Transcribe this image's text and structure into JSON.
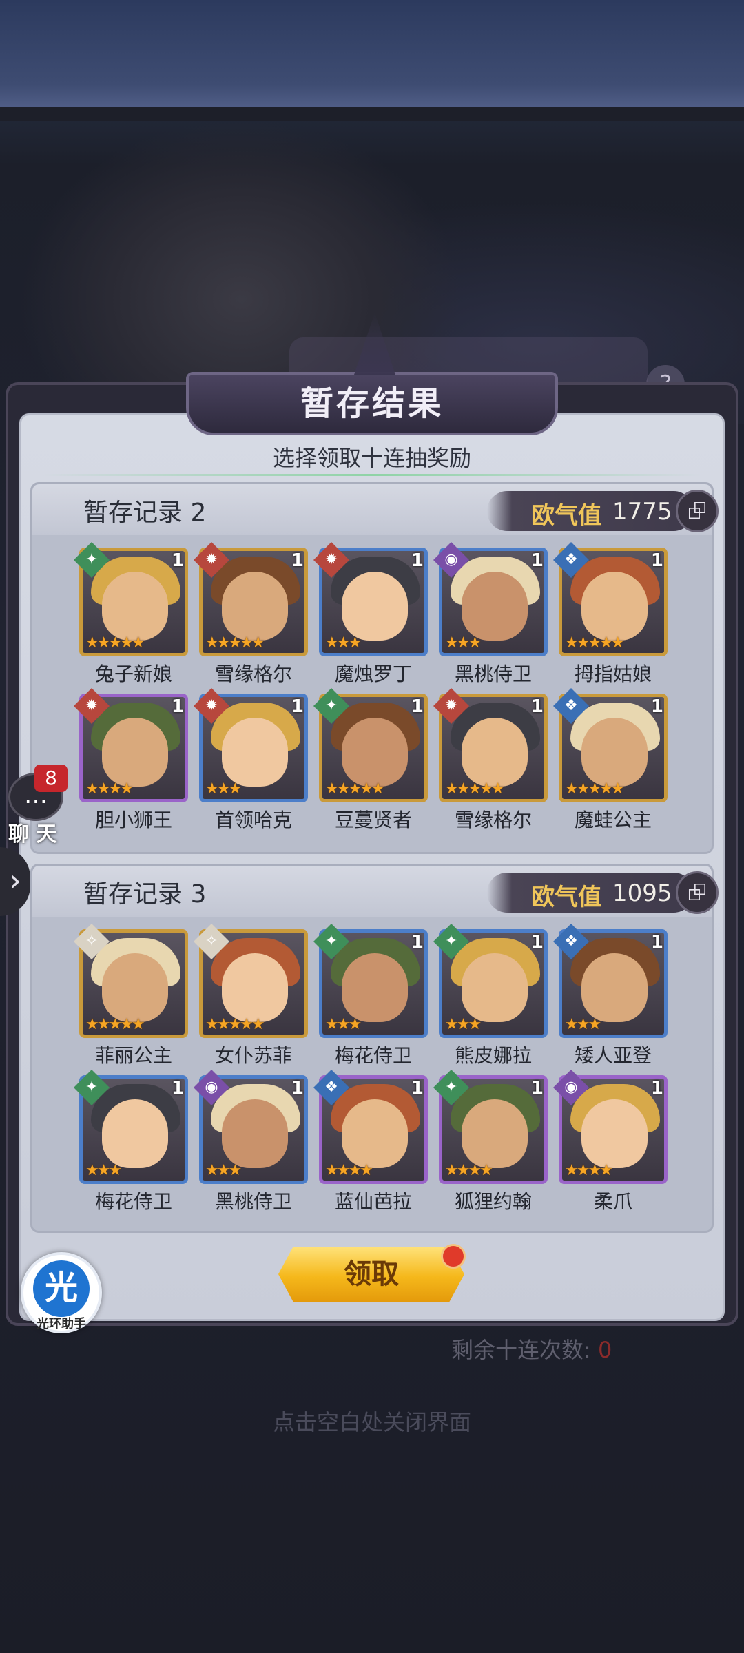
{
  "panel": {
    "title": "暂存结果",
    "subtitle": "选择领取十连抽奖励"
  },
  "records": [
    {
      "title": "暂存记录 2",
      "luck_label": "欧气值",
      "luck_value": "1775",
      "heroes": [
        {
          "name": "兔子新娘",
          "level": "1",
          "stars": 5,
          "frame": "gold",
          "faction": "green"
        },
        {
          "name": "雪缘格尔",
          "level": "1",
          "stars": 5,
          "frame": "gold",
          "faction": "red"
        },
        {
          "name": "魔烛罗丁",
          "level": "1",
          "stars": 3,
          "frame": "blue",
          "faction": "red"
        },
        {
          "name": "黑桃侍卫",
          "level": "1",
          "stars": 3,
          "frame": "blue",
          "faction": "purple"
        },
        {
          "name": "拇指姑娘",
          "level": "1",
          "stars": 5,
          "frame": "gold",
          "faction": "blue"
        },
        {
          "name": "胆小狮王",
          "level": "1",
          "stars": 4,
          "frame": "purple",
          "faction": "red"
        },
        {
          "name": "首领哈克",
          "level": "1",
          "stars": 3,
          "frame": "blue",
          "faction": "red"
        },
        {
          "name": "豆蔓贤者",
          "level": "1",
          "stars": 5,
          "frame": "gold",
          "faction": "green"
        },
        {
          "name": "雪缘格尔",
          "level": "1",
          "stars": 5,
          "frame": "gold",
          "faction": "red"
        },
        {
          "name": "魔蛙公主",
          "level": "1",
          "stars": 5,
          "frame": "gold",
          "faction": "blue"
        }
      ]
    },
    {
      "title": "暂存记录 3",
      "luck_label": "欧气值",
      "luck_value": "1095",
      "heroes": [
        {
          "name": "菲丽公主",
          "level": "",
          "stars": 5,
          "frame": "gold",
          "faction": "white"
        },
        {
          "name": "女仆苏菲",
          "level": "",
          "stars": 5,
          "frame": "gold",
          "faction": "white"
        },
        {
          "name": "梅花侍卫",
          "level": "1",
          "stars": 3,
          "frame": "blue",
          "faction": "green"
        },
        {
          "name": "熊皮娜拉",
          "level": "1",
          "stars": 3,
          "frame": "blue",
          "faction": "green"
        },
        {
          "name": "矮人亚登",
          "level": "1",
          "stars": 3,
          "frame": "blue",
          "faction": "blue"
        },
        {
          "name": "梅花侍卫",
          "level": "1",
          "stars": 3,
          "frame": "blue",
          "faction": "green"
        },
        {
          "name": "黑桃侍卫",
          "level": "1",
          "stars": 3,
          "frame": "blue",
          "faction": "purple"
        },
        {
          "name": "蓝仙芭拉",
          "level": "1",
          "stars": 4,
          "frame": "purple",
          "faction": "blue"
        },
        {
          "name": "狐狸约翰",
          "level": "1",
          "stars": 4,
          "frame": "purple",
          "faction": "green"
        },
        {
          "name": "柔爪",
          "level": "1",
          "stars": 4,
          "frame": "purple",
          "faction": "purple"
        }
      ]
    }
  ],
  "claim_button": "领取",
  "remaining": {
    "label": "剩余十连次数:",
    "value": "0"
  },
  "close_hint": "点击空白处关闭界面",
  "chat": {
    "label": "聊 天",
    "badge": "8"
  },
  "halo_helper": {
    "icon_char": "光",
    "label": "光环助手"
  },
  "bg_help_icon": "?",
  "colors": {
    "frame_gold": "#c99a3b",
    "frame_purple": "#9a64c9",
    "frame_blue": "#4c7ec9",
    "star": "#f6a524",
    "luck_gold": "#f0c65a",
    "claim_button": "#f5b81b"
  }
}
